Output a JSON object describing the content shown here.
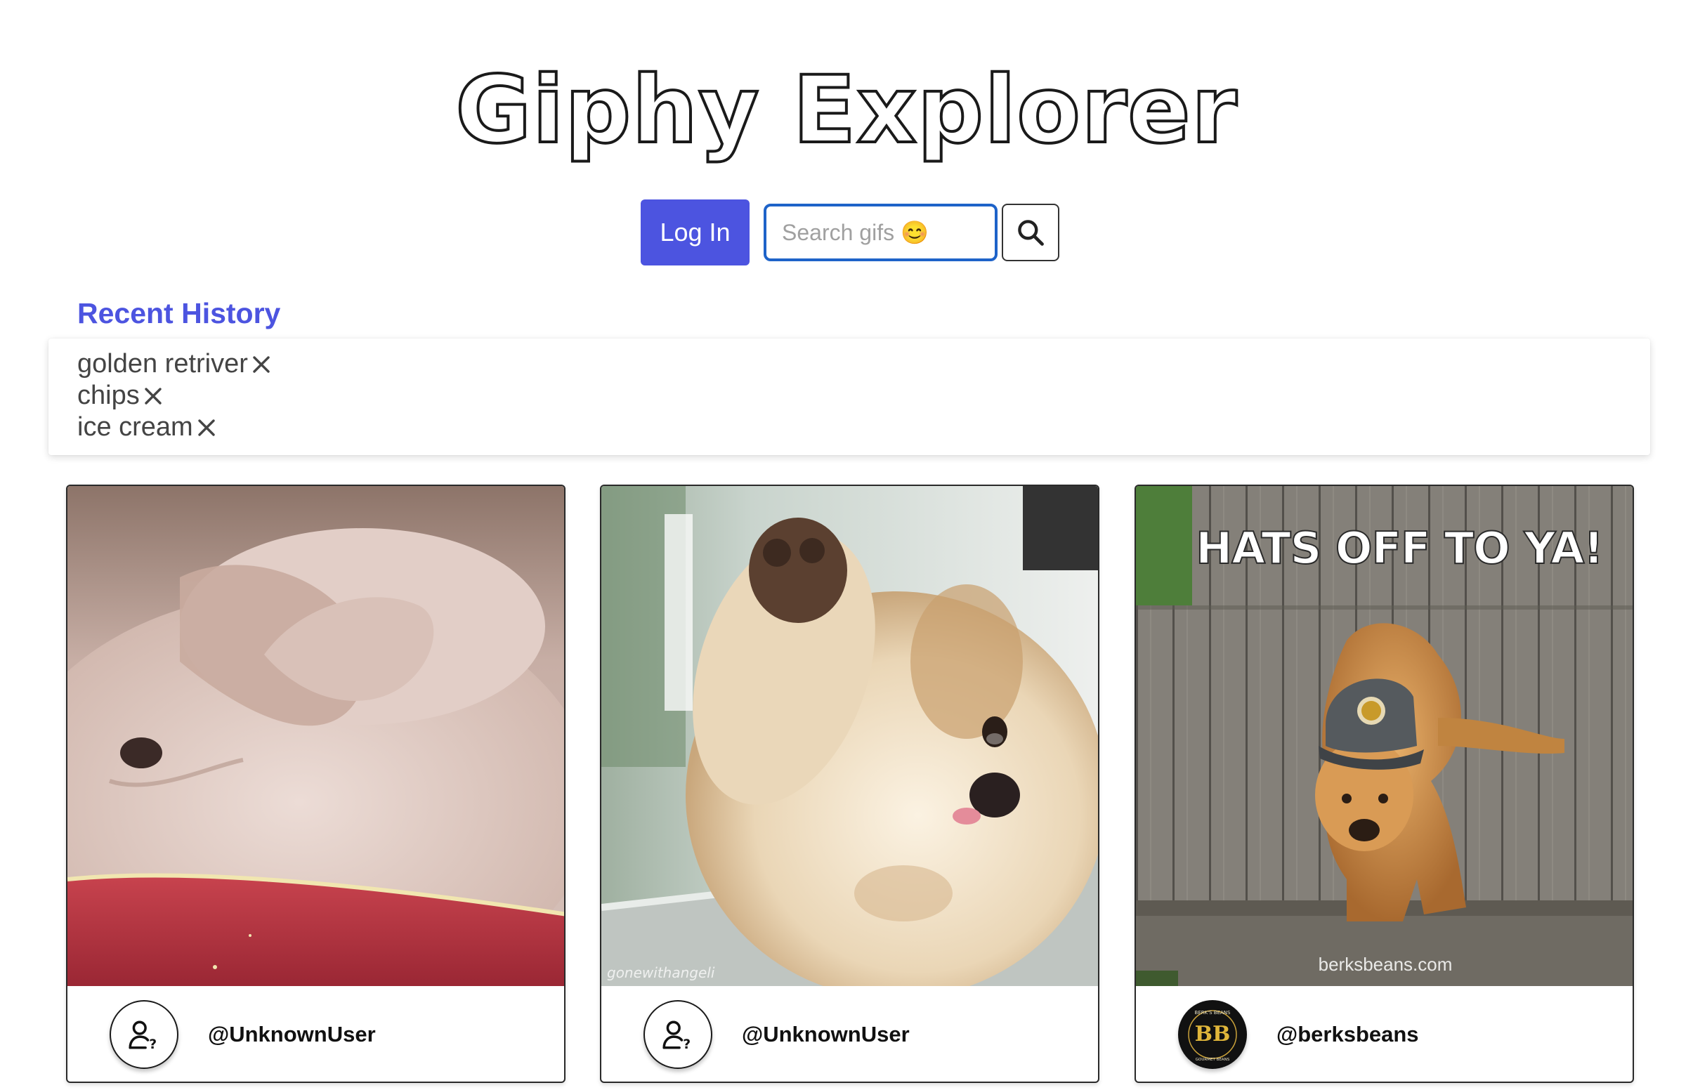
{
  "app": {
    "title": "Giphy Explorer"
  },
  "controls": {
    "login_label": "Log In",
    "search_placeholder": "Search gifs 😊",
    "search_value": ""
  },
  "history": {
    "heading": "Recent History",
    "items": [
      {
        "label": "golden retriver"
      },
      {
        "label": "chips"
      },
      {
        "label": "ice cream"
      }
    ]
  },
  "gifs": [
    {
      "username": "@UnknownUser",
      "avatar_icon": "unknown-user-icon"
    },
    {
      "username": "@UnknownUser",
      "avatar_icon": "unknown-user-icon",
      "watermark": "gonewithangeli"
    },
    {
      "username": "@berksbeans",
      "avatar_icon": "berksbeans-logo",
      "caption": "HATS OFF TO YA!",
      "watermark": "berksbeans.com",
      "avatar_logo_text": "BERK'S BEANS GOURMET BEANS DONE YOUR WAY"
    }
  ],
  "colors": {
    "accent": "#4c54e0",
    "search_border": "#1e63c9"
  }
}
